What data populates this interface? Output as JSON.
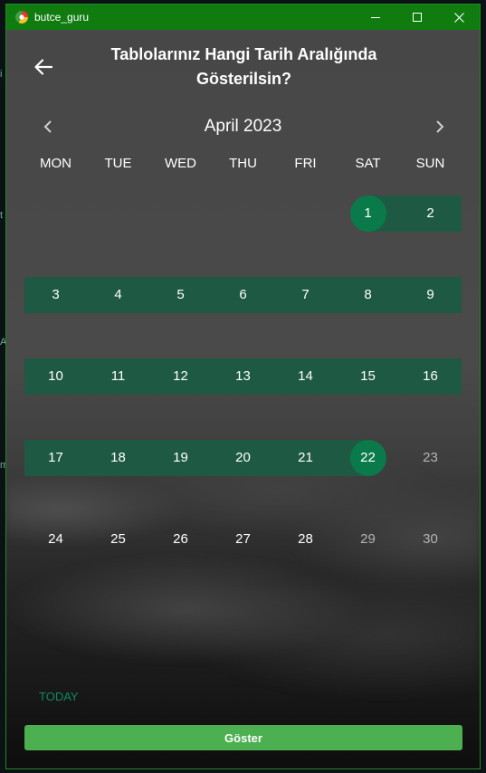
{
  "window": {
    "title": "butce_guru",
    "title_bar_color": "#107c10",
    "border_color": "#1f8a1f",
    "controls": [
      "minimize-icon",
      "maximize-icon",
      "close-icon"
    ]
  },
  "header": {
    "back_icon": "arrow-left-icon",
    "title": "Tablolarınız Hangi Tarih Aralığında Gösterilsin?"
  },
  "calendar": {
    "month_label": "April 2023",
    "prev_icon": "chevron-left-icon",
    "next_icon": "chevron-right-icon",
    "weekdays": [
      "MON",
      "TUE",
      "WED",
      "THU",
      "FRI",
      "SAT",
      "SUN"
    ],
    "weeks": [
      [
        "",
        "",
        "",
        "",
        "",
        "1",
        "2"
      ],
      [
        "3",
        "4",
        "5",
        "6",
        "7",
        "8",
        "9"
      ],
      [
        "10",
        "11",
        "12",
        "13",
        "14",
        "15",
        "16"
      ],
      [
        "17",
        "18",
        "19",
        "20",
        "21",
        "22",
        "23"
      ],
      [
        "24",
        "25",
        "26",
        "27",
        "28",
        "29",
        "30"
      ]
    ],
    "range_start": "1",
    "range_end": "22",
    "accent_color": "#0b7a4a",
    "range_color": "#1e5a43"
  },
  "footer": {
    "today_label": "TODAY",
    "submit_label": "Göster",
    "submit_color": "#4caf50"
  }
}
